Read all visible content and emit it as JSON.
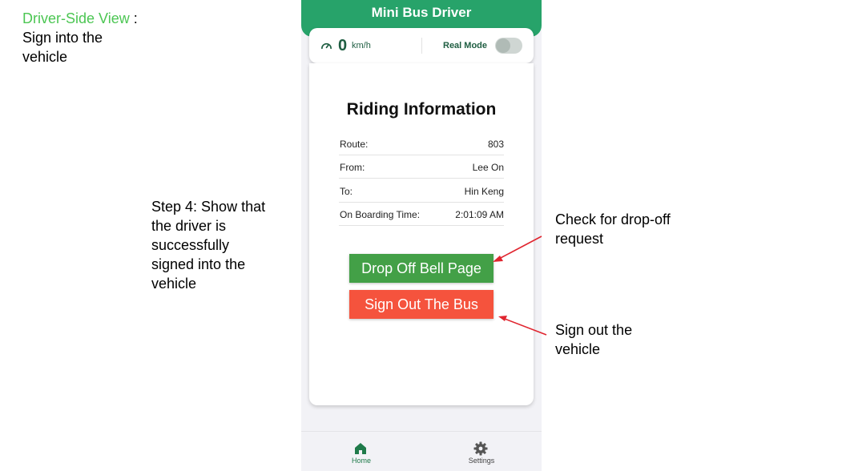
{
  "slide": {
    "title_accent": "Driver-Side View",
    "title_rest": " :",
    "subtitle": "Sign into the vehicle",
    "step_note": "Step 4: Show that the driver is successfully signed into the vehicle",
    "annotation_check": "Check for drop-off request",
    "annotation_signout": "Sign out the vehicle",
    "accent_color": "#4cc653",
    "arrow_color": "#e0252f"
  },
  "app": {
    "title": "Mini Bus Driver",
    "header_color": "#27a36a",
    "speed": {
      "icon": "speedometer-icon",
      "value": "0",
      "unit": "km/h"
    },
    "mode": {
      "label": "Real Mode",
      "enabled": false
    },
    "riding": {
      "title": "Riding Information",
      "rows": [
        {
          "key": "Route:",
          "value": "803"
        },
        {
          "key": "From:",
          "value": "Lee On"
        },
        {
          "key": "To:",
          "value": "Hin Keng"
        },
        {
          "key": "On Boarding Time:",
          "value": "2:01:09 AM"
        }
      ]
    },
    "buttons": {
      "drop_off": "Drop Off Bell Page",
      "sign_out": "Sign Out The Bus",
      "drop_off_color": "#43a047",
      "sign_out_color": "#f5533d"
    },
    "tabs": [
      {
        "label": "Home",
        "icon": "home-icon",
        "active": true
      },
      {
        "label": "Settings",
        "icon": "gear-icon",
        "active": false
      }
    ]
  }
}
